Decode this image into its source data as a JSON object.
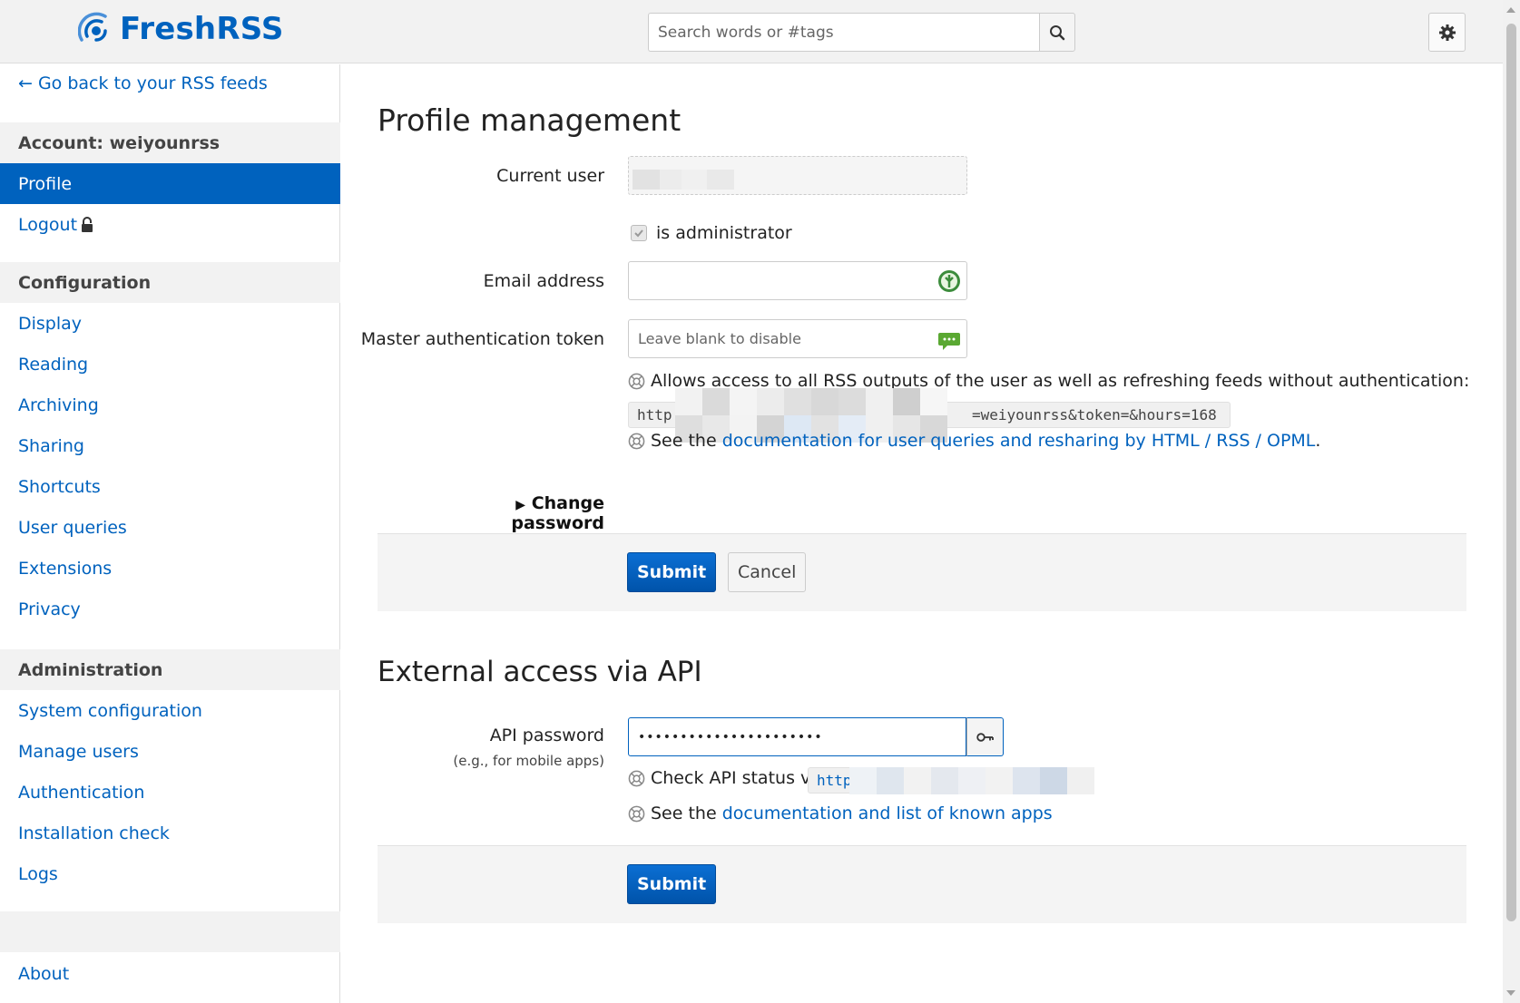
{
  "header": {
    "logo_text": "FreshRSS",
    "search_placeholder": "Search words or #tags"
  },
  "sidebar": {
    "back_link": "← Go back to your RSS feeds",
    "account_header": "Account: weiyounrss",
    "account_items": [
      {
        "label": "Profile",
        "active": true
      },
      {
        "label": "Logout"
      }
    ],
    "configuration_header": "Configuration",
    "configuration_items": [
      "Display",
      "Reading",
      "Archiving",
      "Sharing",
      "Shortcuts",
      "User queries",
      "Extensions",
      "Privacy"
    ],
    "administration_header": "Administration",
    "administration_items": [
      "System configuration",
      "Manage users",
      "Authentication",
      "Installation check",
      "Logs"
    ],
    "about": "About"
  },
  "profile": {
    "title": "Profile management",
    "current_user_label": "Current user",
    "is_admin_label": "is administrator",
    "is_admin_checked": true,
    "email_label": "Email address",
    "email_value": "",
    "token_label": "Master authentication token",
    "token_placeholder": "Leave blank to disable",
    "token_help": "Allows access to all RSS outputs of the user as well as refreshing feeds without authentication:",
    "token_url_start": "http",
    "token_url_end": "=weiyounrss&token=&hours=168",
    "see_the": "See the",
    "doc_link": "documentation for user queries and resharing by HTML / RSS / OPML",
    "doc_period": ".",
    "change_password": "Change password",
    "submit": "Submit",
    "cancel": "Cancel"
  },
  "api": {
    "title": "External access via API",
    "password_label": "API password",
    "password_sublabel": "(e.g., for mobile apps)",
    "password_value": "••••••••••••••••••••••",
    "check_status": "Check API status via:",
    "status_url_start": "http",
    "see_the": "See the",
    "doc_link": "documentation and list of known apps",
    "submit": "Submit"
  }
}
